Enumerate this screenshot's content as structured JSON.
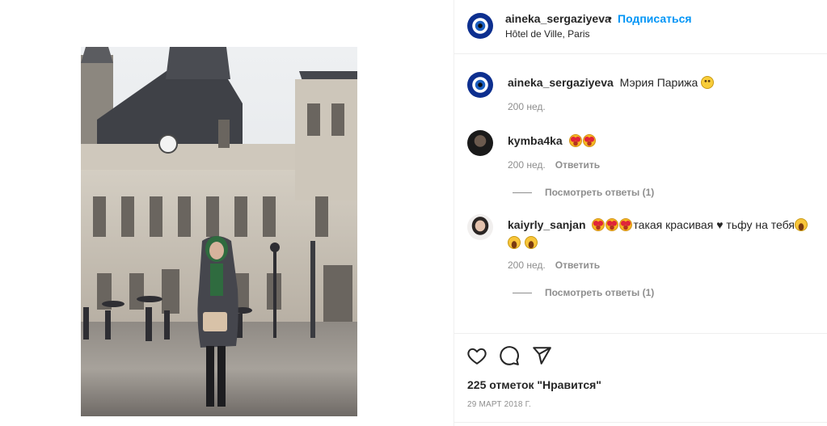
{
  "post": {
    "photo_description": "",
    "header": {
      "username": "aineka_sergaziyeva",
      "separator": "•",
      "follow_label": "Подписаться",
      "location": "Hôtel de Ville, Paris",
      "avatar_icon": "evil-eye-icon"
    },
    "caption": {
      "username": "aineka_sergaziyeva",
      "text": "Мэрия Парижа",
      "emoji": "smile-emoji",
      "time": "200 нед."
    },
    "comments": [
      {
        "username": "kymba4ka",
        "emojis": [
          "heart-eyes-emoji",
          "heart-eyes-emoji"
        ],
        "text": "",
        "time": "200 нед.",
        "reply_label": "Ответить",
        "view_replies_label": "Посмотреть ответы (1)"
      },
      {
        "username": "kaiyrly_sanjan",
        "emojis": [
          "heart-eyes-emoji",
          "heart-eyes-emoji",
          "heart-eyes-emoji"
        ],
        "text_1": "такая красивая",
        "heart_symbol": "♥",
        "text_2": "тьфу на тебя",
        "time": "200 нед.",
        "reply_label": "Ответить",
        "view_replies_label": "Посмотреть ответы (1)"
      }
    ],
    "actions": {
      "like_icon": "heart-outline-icon",
      "comment_icon": "comment-bubble-icon",
      "share_icon": "paper-plane-icon"
    },
    "likes": "225 отметок \"Нравится\"",
    "date": "29 МАРТ 2018 Г."
  },
  "colors": {
    "link_blue": "#0095f6",
    "text": "#262626",
    "secondary": "#8e8e8e",
    "border": "#efefef"
  }
}
